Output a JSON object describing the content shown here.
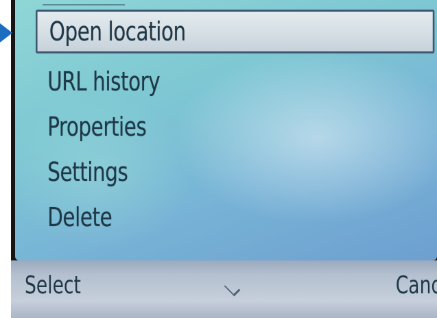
{
  "menu": {
    "items": [
      {
        "label": "Open location",
        "selected": true
      },
      {
        "label": "URL history",
        "selected": false
      },
      {
        "label": "Properties",
        "selected": false
      },
      {
        "label": "Settings",
        "selected": false
      },
      {
        "label": "Delete",
        "selected": false
      }
    ]
  },
  "softkeys": {
    "left_label": "Select",
    "middle_icon": "chevron-down-icon",
    "right_label": "Cancel"
  },
  "indicator": {
    "icon": "pointer-arrow-icon",
    "color": "#1c6dbf"
  },
  "colors": {
    "screen": "#7ec8d3",
    "softkey_bar": "#b4c0cf",
    "selection": "#d4dde3",
    "text": "#1f3848"
  }
}
